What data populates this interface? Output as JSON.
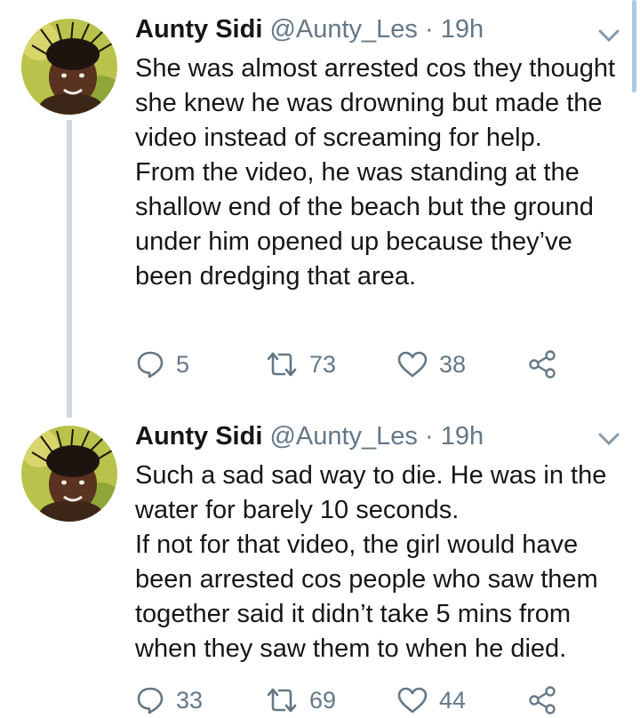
{
  "tweets": [
    {
      "name": "Aunty Sidi",
      "handle": "@Aunty_Les",
      "separator": "·",
      "time": "19h",
      "paragraphs": [
        "She was almost arrested cos they thought she knew he was drowning but made the video instead of screaming for help.",
        "From the video, he was standing at the shallow end of the beach but the ground under him opened up because they’ve been dredging that area."
      ],
      "replies": "5",
      "retweets": "73",
      "likes": "38"
    },
    {
      "name": "Aunty Sidi",
      "handle": "@Aunty_Les",
      "separator": "·",
      "time": "19h",
      "paragraphs": [
        "Such a sad sad way to die. He was in the water for barely 10 seconds.",
        "If not for that video, the girl would have been arrested cos people who saw them together said it didn’t take 5 mins from when they saw them to when he died."
      ],
      "replies": "33",
      "retweets": "69",
      "likes": "44"
    }
  ],
  "colors": {
    "text": "#14171a",
    "muted": "#657786",
    "thread_line": "#d0d7dd",
    "scrollbar": "#a7cde3"
  },
  "icons": [
    "avatar",
    "chevron-down-icon",
    "reply-icon",
    "retweet-icon",
    "like-icon",
    "share-icon"
  ]
}
